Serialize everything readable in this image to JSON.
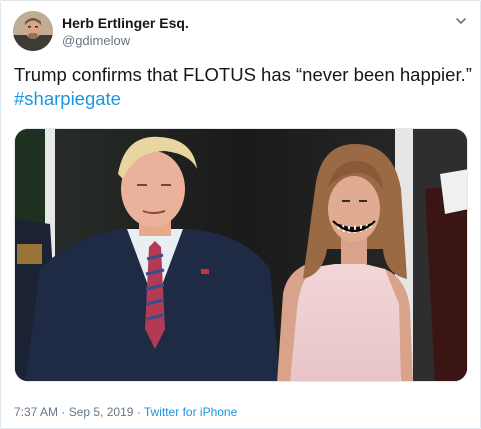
{
  "author": {
    "display_name": "Herb Ertlinger Esq.",
    "handle": "@gdimelow"
  },
  "tweet": {
    "text_line1": "Trump confirms that FLOTUS has “never been happier.”",
    "hashtag": "#sharpiegate"
  },
  "meta": {
    "time": "7:37 AM",
    "separator1": " · ",
    "date": "Sep 5, 2019",
    "separator2": " · ",
    "source": "Twitter for iPhone"
  },
  "icons": {
    "menu": "chevron-down-icon"
  },
  "colors": {
    "link": "#1b95e0",
    "secondary_text": "#657786",
    "primary_text": "#14171a",
    "border": "#e1e8ed"
  }
}
